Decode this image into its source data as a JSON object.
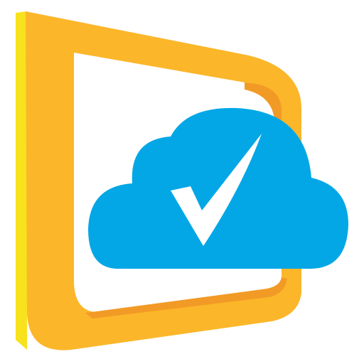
{
  "icon": {
    "name": "cloud-check-app-icon",
    "parts": [
      "frame-icon",
      "cloud-icon",
      "checkmark-icon"
    ]
  },
  "colors": {
    "background": "#ffffff",
    "frame_front": "#fbb62a",
    "frame_edge_yellow": "#f7e21d",
    "frame_shadow_orange": "#f29a26",
    "cloud": "#03a7e6",
    "checkmark": "#ffffff"
  }
}
